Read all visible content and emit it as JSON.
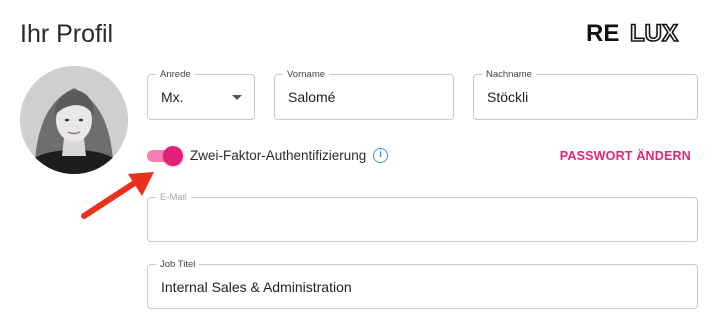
{
  "header": {
    "title": "Ihr Profil",
    "logo_text_1": "RE",
    "logo_text_2": "LUX"
  },
  "form": {
    "anrede": {
      "label": "Anrede",
      "value": "Mx."
    },
    "vorname": {
      "label": "Vorname",
      "value": "Salomé"
    },
    "nachname": {
      "label": "Nachname",
      "value": "Stöckli"
    },
    "email": {
      "label": "E-Mail",
      "value": ""
    },
    "job_titel": {
      "label": "Job Titel",
      "value": "Internal Sales & Administration"
    }
  },
  "two_factor": {
    "label": "Zwei-Faktor-Authentifizierung",
    "enabled": true,
    "info_glyph": "i"
  },
  "password_link": "PASSWORT ÄNDERN",
  "colors": {
    "accent": "#e4237c",
    "toggle_track": "#f27fb6",
    "info": "#3d9ad6",
    "annotation_arrow": "#e8301c"
  },
  "icons": {
    "info": "info-icon",
    "dropdown": "chevron-down-icon",
    "annotation": "red-arrow-icon"
  }
}
